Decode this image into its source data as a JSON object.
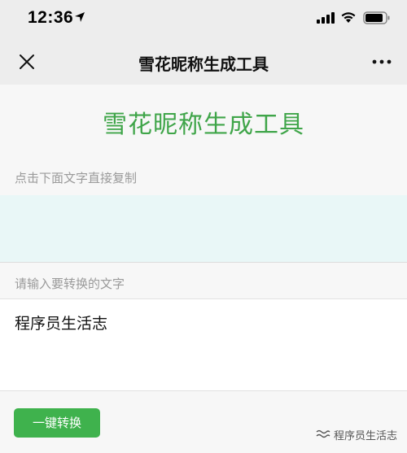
{
  "status_bar": {
    "time": "12:36"
  },
  "nav": {
    "title": "雪花昵称生成工具",
    "close_icon": "close-icon",
    "more_icon": "more-icon"
  },
  "main": {
    "heading": "雪花昵称生成工具",
    "output_label": "点击下面文字直接复制",
    "output_value": "",
    "input_label": "请输入要转换的文字",
    "input_value": "程序员生活志",
    "convert_button_label": "一键转换"
  },
  "watermark": {
    "text": "程序员生活志"
  },
  "colors": {
    "accent_green": "#3fa549",
    "button_green": "#3fb24d",
    "output_bg": "#e9f7f7",
    "page_bg": "#f7f7f7",
    "nav_bg": "#ededed"
  }
}
